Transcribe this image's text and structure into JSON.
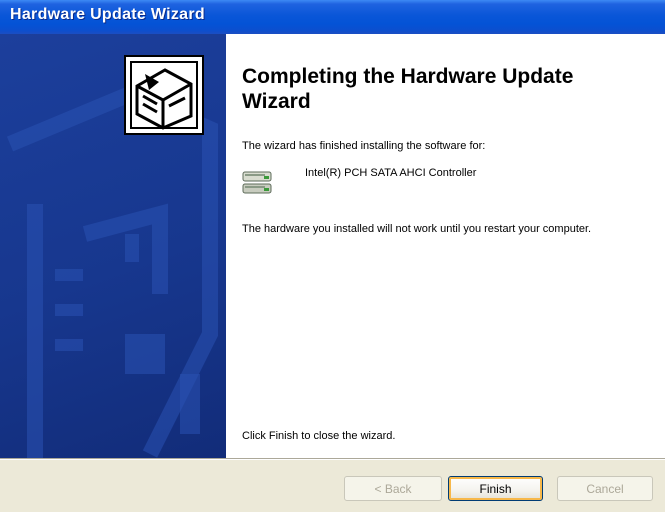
{
  "window": {
    "title": "Hardware Update Wizard"
  },
  "content": {
    "heading": "Completing the Hardware Update Wizard",
    "finished_text": "The wizard has finished installing the software for:",
    "device_name": "Intel(R) PCH SATA AHCI Controller",
    "restart_text": "The hardware you installed will not work until you restart your computer.",
    "close_text": "Click Finish to close the wizard."
  },
  "buttons": {
    "back": "< Back",
    "finish": "Finish",
    "cancel": "Cancel"
  },
  "icons": {
    "wizard": "hardware-card-icon",
    "device": "disk-controller-icon"
  },
  "colors": {
    "titlebar": "#0453d6",
    "side_panel": "#17378e",
    "dialog_face": "#ece9d8"
  }
}
